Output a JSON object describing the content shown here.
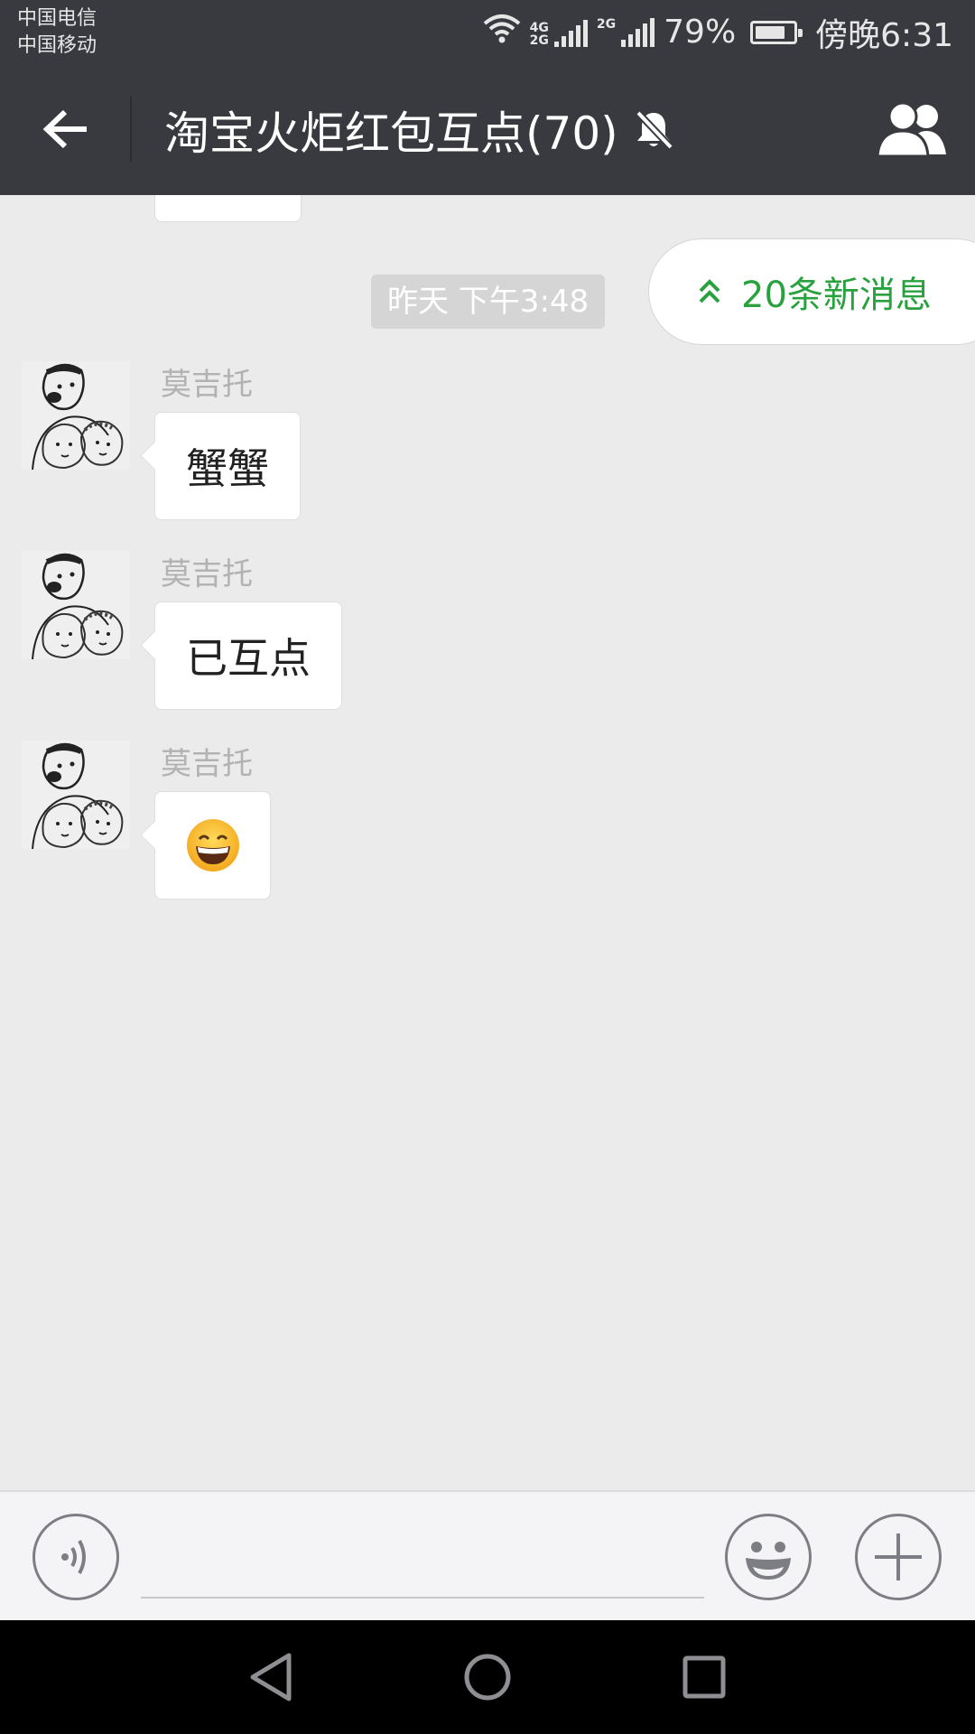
{
  "status_bar": {
    "carrier_1": "中国电信",
    "carrier_2": "中国移动",
    "signal_1_label_top": "4G",
    "signal_1_label_bottom": "2G",
    "signal_2_label": "2G",
    "battery_percent": "79%",
    "battery_level": 0.79,
    "time": "傍晚6:31"
  },
  "header": {
    "title": "淘宝火炬红包互点(70)",
    "back_icon": "arrow-left-icon",
    "mute_icon": "bell-off-icon",
    "members_icon": "group-people-icon"
  },
  "chat": {
    "timestamp": "昨天 下午3:48",
    "new_messages_label": "20条新消息",
    "new_messages_icon": "double-chevron-up-icon",
    "messages": [
      {
        "sender": "莫吉托",
        "text": "蟹蟹"
      },
      {
        "sender": "莫吉托",
        "text": "已互点"
      },
      {
        "sender": "莫吉托",
        "text": "😄"
      }
    ]
  },
  "input_bar": {
    "voice_icon": "voice-icon",
    "input_value": "",
    "emoji_icon": "smiley-icon",
    "plus_icon": "plus-icon"
  },
  "nav_bar": {
    "back_icon": "triangle-back-icon",
    "home_icon": "circle-home-icon",
    "recent_icon": "square-recent-icon"
  },
  "colors": {
    "header_bg": "#393a3f",
    "chat_bg": "#ebebeb",
    "accent_green": "#2aa13f"
  }
}
